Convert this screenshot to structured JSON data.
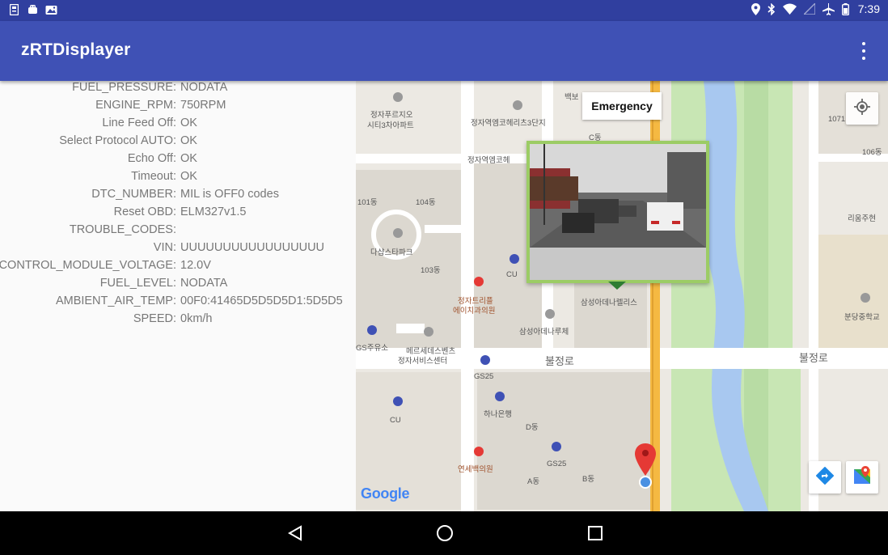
{
  "status_bar": {
    "time": "7:39",
    "left_icons": [
      "sim-card-icon",
      "android-icon",
      "photo-icon"
    ],
    "right_icons": [
      "location-icon",
      "bluetooth-icon",
      "wifi-icon",
      "signal-off-icon",
      "airplane-mode-icon",
      "battery-icon"
    ]
  },
  "app_bar": {
    "title": "zRTDisplayer",
    "menu_icon": "more-vert-icon"
  },
  "obd_data": [
    {
      "label": "FUEL_PRESSURE:",
      "value": "NODATA"
    },
    {
      "label": "ENGINE_RPM:",
      "value": "750RPM"
    },
    {
      "label": "Line Feed Off:",
      "value": "OK"
    },
    {
      "label": "Select Protocol AUTO:",
      "value": "OK"
    },
    {
      "label": "Echo Off:",
      "value": "OK"
    },
    {
      "label": "Timeout:",
      "value": "OK"
    },
    {
      "label": "DTC_NUMBER:",
      "value": "MIL is OFF0 codes"
    },
    {
      "label": "Reset OBD:",
      "value": "ELM327v1.5"
    },
    {
      "label": "TROUBLE_CODES:",
      "value": ""
    },
    {
      "label": "VIN:",
      "value": "UUUUUUUUUUUUUUUUU"
    },
    {
      "label": "CONTROL_MODULE_VOLTAGE:",
      "value": "12.0V"
    },
    {
      "label": "FUEL_LEVEL:",
      "value": "NODATA"
    },
    {
      "label": "AMBIENT_AIR_TEMP:",
      "value": "00F0:41465D5D5D5D1:5D5D5"
    },
    {
      "label": "SPEED:",
      "value": "0km/h"
    }
  ],
  "map": {
    "marker_title": "Emergency",
    "provider": "Google",
    "road_labels": [
      "불정로",
      "불정로"
    ],
    "place_labels": [
      "정자푸르지오",
      "시티3차아파트",
      "정자역엠코헤리츠3단지",
      "정자역엠코헤",
      "101동",
      "104동",
      "다샵스타파크",
      "103동",
      "CU",
      "정자트리플",
      "에이치과의원",
      "삼성아데나렐리스",
      "삼성아데나루체",
      "GS주유소",
      "메르세데스벤츠",
      "정자서비스센터",
      "GS25",
      "하나은행",
      "D동",
      "연세백의원",
      "GS25",
      "A동",
      "B동",
      "분당중학교",
      "리움주현",
      "106동",
      "1071",
      "CU",
      "백보",
      "C동"
    ],
    "colors": {
      "marker": "#e53935",
      "popup_border": "#9ccc65",
      "water": "#a8c8f0",
      "park": "#c8e6b4",
      "highway": "#f5b942"
    }
  },
  "nav_bar": {
    "back_icon": "back-triangle-icon",
    "home_icon": "home-circle-icon",
    "recents_icon": "recents-square-icon"
  }
}
